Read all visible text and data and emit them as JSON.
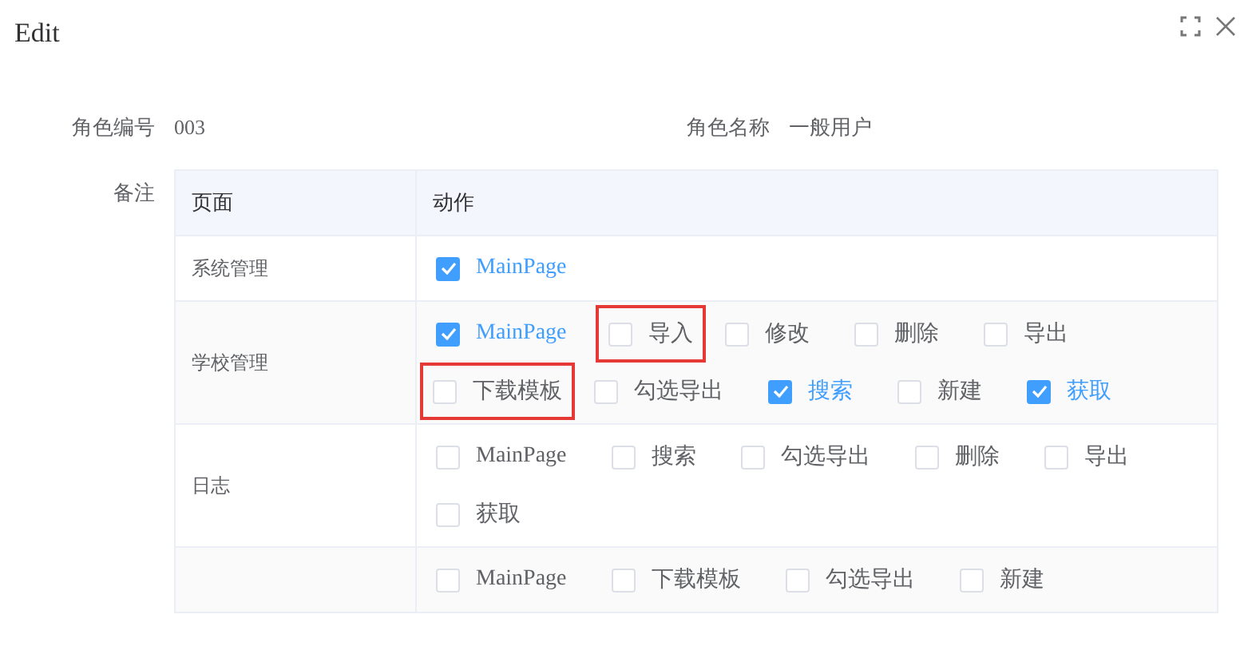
{
  "dialog": {
    "title": "Edit"
  },
  "fields": [
    {
      "label": "角色编号",
      "value": "003"
    },
    {
      "label": "角色名称",
      "value": "一般用户"
    }
  ],
  "remark_label": "备注",
  "table": {
    "columns": [
      "页面",
      "动作"
    ],
    "rows": [
      {
        "page": "系统管理",
        "actions": [
          {
            "label": "MainPage",
            "checked": true,
            "highlighted": false
          }
        ]
      },
      {
        "page": "学校管理",
        "actions": [
          {
            "label": "MainPage",
            "checked": true,
            "highlighted": false
          },
          {
            "label": "导入",
            "checked": false,
            "highlighted": true
          },
          {
            "label": "修改",
            "checked": false,
            "highlighted": false
          },
          {
            "label": "删除",
            "checked": false,
            "highlighted": false
          },
          {
            "label": "导出",
            "checked": false,
            "highlighted": false
          },
          {
            "label": "下载模板",
            "checked": false,
            "highlighted": true
          },
          {
            "label": "勾选导出",
            "checked": false,
            "highlighted": false
          },
          {
            "label": "搜索",
            "checked": true,
            "highlighted": false
          },
          {
            "label": "新建",
            "checked": false,
            "highlighted": false
          },
          {
            "label": "获取",
            "checked": true,
            "highlighted": false
          }
        ]
      },
      {
        "page": "日志",
        "actions": [
          {
            "label": "MainPage",
            "checked": false,
            "highlighted": false
          },
          {
            "label": "搜索",
            "checked": false,
            "highlighted": false
          },
          {
            "label": "勾选导出",
            "checked": false,
            "highlighted": false
          },
          {
            "label": "删除",
            "checked": false,
            "highlighted": false
          },
          {
            "label": "导出",
            "checked": false,
            "highlighted": false
          },
          {
            "label": "获取",
            "checked": false,
            "highlighted": false
          }
        ]
      },
      {
        "page": "",
        "actions": [
          {
            "label": "MainPage",
            "checked": false,
            "highlighted": false
          },
          {
            "label": "下载模板",
            "checked": false,
            "highlighted": false
          },
          {
            "label": "勾选导出",
            "checked": false,
            "highlighted": false
          },
          {
            "label": "新建",
            "checked": false,
            "highlighted": false
          }
        ]
      }
    ]
  }
}
